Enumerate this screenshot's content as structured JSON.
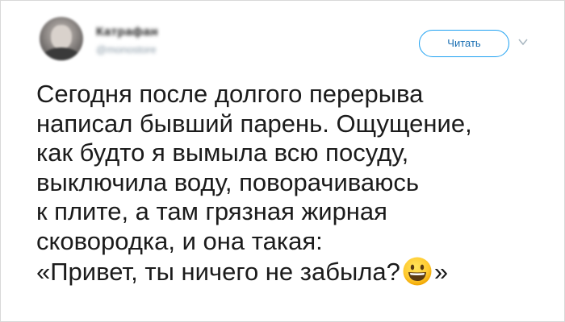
{
  "user": {
    "name": "Катрафан",
    "handle": "@monostore"
  },
  "follow_label": "Читать",
  "tweet_lines": [
    "Сегодня после долгого перерыва",
    "написал бывший парень. Ощущение,",
    "как будто я вымыла всю посуду,",
    "выключила воду, поворачиваюсь",
    "к плите, а там грязная жирная",
    "сковородка, и она такая:"
  ],
  "tweet_last_before": "«Привет, ты ничего не забыла?",
  "tweet_last_after": "»",
  "icons": {
    "chevron": "chevron-down-icon",
    "emoji": "grinning-face-emoji"
  },
  "colors": {
    "accent": "#1da1f2",
    "accent_text": "#1a6fb3",
    "text": "#1b1b1b",
    "muted": "#8899a6"
  }
}
